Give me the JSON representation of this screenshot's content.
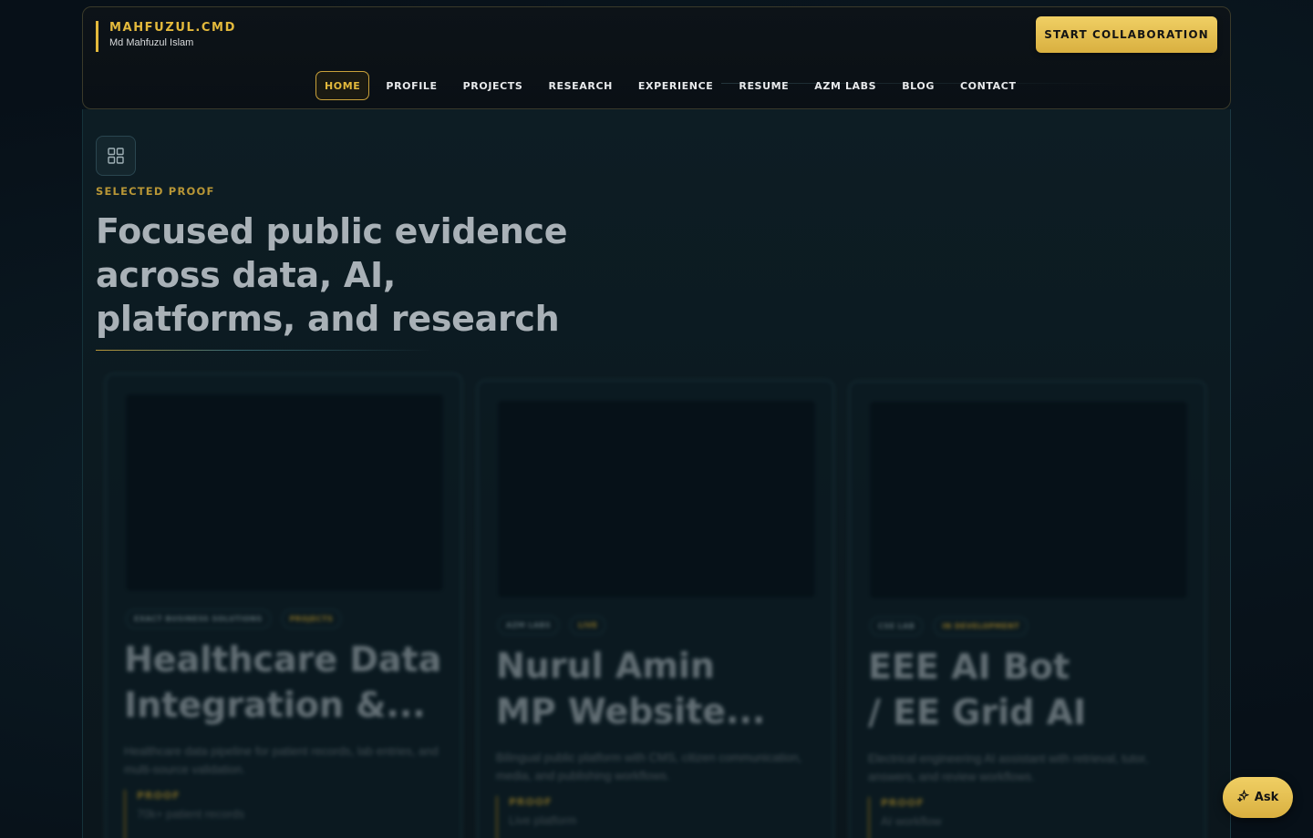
{
  "brand": {
    "name": "MAHFUZUL.CMD",
    "subtitle": "Md Mahfuzul Islam"
  },
  "header": {
    "cta_label": "START COLLABORATION"
  },
  "nav": {
    "items": [
      {
        "label": "HOME",
        "active": true
      },
      {
        "label": "PROFILE"
      },
      {
        "label": "PROJECTS"
      },
      {
        "label": "RESEARCH"
      },
      {
        "label": "EXPERIENCE"
      },
      {
        "label": "RESUME"
      },
      {
        "label": "AZM LABS"
      },
      {
        "label": "BLOG"
      },
      {
        "label": "CONTACT"
      }
    ]
  },
  "section": {
    "icon": "grid-icon",
    "eyebrow": "SELECTED PROOF",
    "headline_lines": [
      "Focused public evidence",
      "across data, AI,",
      "platforms, and research"
    ]
  },
  "cards": [
    {
      "tags": [
        "EXACT BUSINESS SOLUTIONS",
        "PROJECTS"
      ],
      "title_lines": [
        "Healthcare Data",
        "Integration &..."
      ],
      "description": "Healthcare data pipeline for patient records, lab entries, and multi-source validation.",
      "proof_label": "PROOF",
      "proof_value": "70k+ patient records"
    },
    {
      "tags": [
        "AZM LABS",
        "LIVE"
      ],
      "title_lines": [
        "Nurul Amin",
        "MP Website..."
      ],
      "description": "Bilingual public platform with CMS, citizen communication, media, and publishing workflows.",
      "proof_label": "PROOF",
      "proof_value": "Live platform"
    },
    {
      "tags": [
        "CSE LAB",
        "IN DEVELOPMENT"
      ],
      "title_lines": [
        "EEE AI Bot",
        "/ EE Grid AI"
      ],
      "description": "Electrical engineering AI assistant with retrieval, tutor, answers, and review workflows.",
      "proof_label": "PROOF",
      "proof_value": "AI workflow"
    }
  ],
  "colors": {
    "accent_gold": "#e3b93c",
    "background": "#071018",
    "panel": "#0d1d24"
  },
  "ask": {
    "label": "Ask",
    "icon": "sparkle-icon"
  }
}
